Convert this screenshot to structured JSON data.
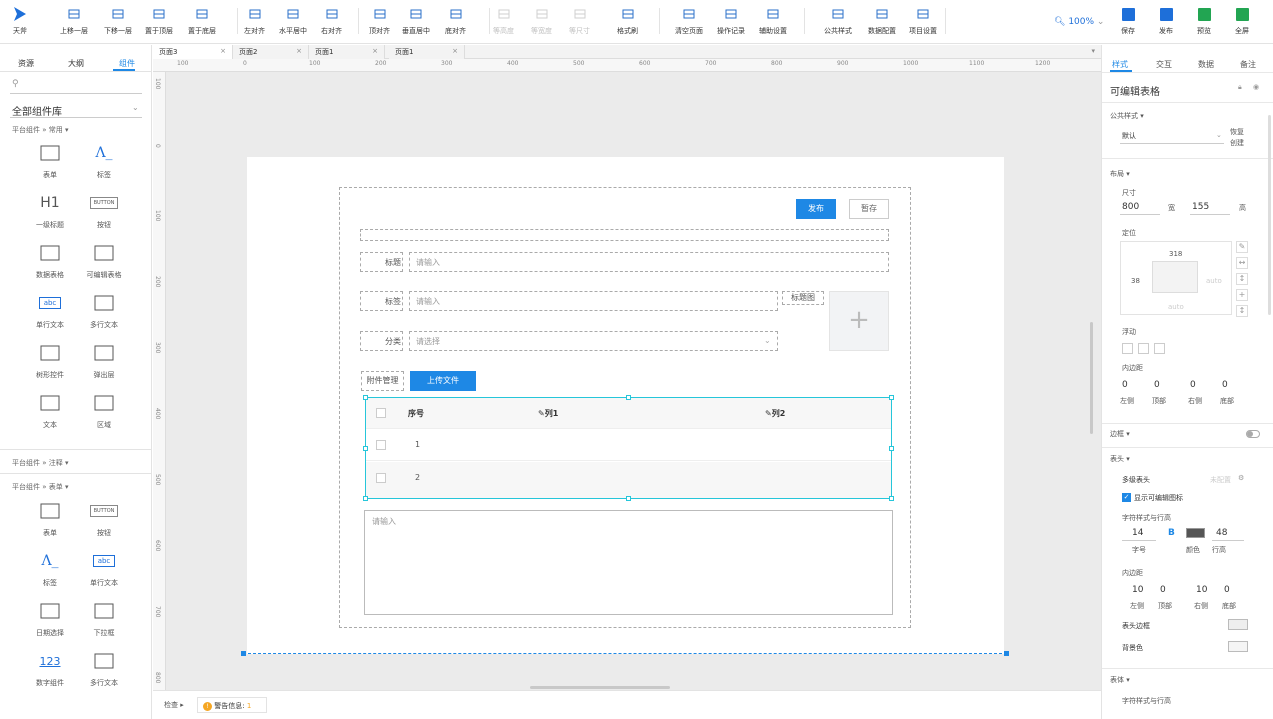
{
  "toolbar": {
    "logo_label": "天斧",
    "items": [
      {
        "label": "上移一层",
        "icon": "move-up-icon",
        "disabled": false
      },
      {
        "label": "下移一层",
        "icon": "move-down-icon",
        "disabled": false
      },
      {
        "label": "置于顶层",
        "icon": "bring-front-icon",
        "disabled": false
      },
      {
        "label": "置于底层",
        "icon": "send-back-icon",
        "disabled": false
      },
      {
        "label": "左对齐",
        "icon": "align-left-icon",
        "disabled": false
      },
      {
        "label": "水平居中",
        "icon": "align-center-h-icon",
        "disabled": false
      },
      {
        "label": "右对齐",
        "icon": "align-right-icon",
        "disabled": false
      },
      {
        "label": "顶对齐",
        "icon": "align-top-icon",
        "disabled": false
      },
      {
        "label": "垂直居中",
        "icon": "align-center-v-icon",
        "disabled": false
      },
      {
        "label": "底对齐",
        "icon": "align-bottom-icon",
        "disabled": false
      },
      {
        "label": "等高度",
        "icon": "same-height-icon",
        "disabled": true
      },
      {
        "label": "等宽度",
        "icon": "same-width-icon",
        "disabled": true
      },
      {
        "label": "等尺寸",
        "icon": "same-size-icon",
        "disabled": true
      },
      {
        "label": "格式刷",
        "icon": "format-brush-icon",
        "disabled": false
      },
      {
        "label": "清空页面",
        "icon": "eraser-icon",
        "disabled": false
      },
      {
        "label": "操作记录",
        "icon": "history-icon",
        "disabled": false
      },
      {
        "label": "辅助设置",
        "icon": "assist-settings-icon",
        "disabled": false
      },
      {
        "label": "公共样式",
        "icon": "public-style-icon",
        "disabled": false
      },
      {
        "label": "数据配置",
        "icon": "database-icon",
        "disabled": false
      },
      {
        "label": "项目设置",
        "icon": "project-settings-icon",
        "disabled": false
      }
    ],
    "zoom": "100%",
    "actions": [
      {
        "label": "保存",
        "icon": "save-icon",
        "color": "#1e6fd9"
      },
      {
        "label": "发布",
        "icon": "publish-icon",
        "color": "#1e6fd9"
      },
      {
        "label": "预览",
        "icon": "preview-icon",
        "color": "#22a552"
      },
      {
        "label": "全屏",
        "icon": "fullscreen-icon",
        "color": "#22a552"
      }
    ]
  },
  "left": {
    "tabs": [
      "资源",
      "大纲",
      "组件"
    ],
    "active_tab": "组件",
    "library": "全部组件库",
    "section1": "平台组件 » 常用",
    "common": [
      {
        "label": "表单",
        "icon": "form-icon"
      },
      {
        "label": "标签",
        "icon": "label-icon",
        "glyph": "A_"
      },
      {
        "label": "一级标题",
        "icon": "heading-icon",
        "glyph": "H1"
      },
      {
        "label": "按钮",
        "icon": "button-icon",
        "glyph": "BUTTON"
      },
      {
        "label": "数据表格",
        "icon": "data-table-icon"
      },
      {
        "label": "可编辑表格",
        "icon": "editable-table-icon"
      },
      {
        "label": "单行文本",
        "icon": "single-line-text-icon",
        "glyph": "abc"
      },
      {
        "label": "多行文本",
        "icon": "multi-line-text-icon"
      },
      {
        "label": "树形控件",
        "icon": "tree-icon"
      },
      {
        "label": "弹出层",
        "icon": "popup-icon"
      },
      {
        "label": "文本",
        "icon": "text-icon"
      },
      {
        "label": "区域",
        "icon": "region-icon"
      }
    ],
    "section2": "平台组件 » 注释",
    "section3": "平台组件 » 表单",
    "forms": [
      {
        "label": "表单",
        "icon": "form-icon"
      },
      {
        "label": "按钮",
        "icon": "button-icon",
        "glyph": "BUTTON"
      },
      {
        "label": "标签",
        "icon": "label-icon",
        "glyph": "A_"
      },
      {
        "label": "单行文本",
        "icon": "single-line-text-icon",
        "glyph": "abc"
      },
      {
        "label": "日期选择",
        "icon": "date-picker-icon"
      },
      {
        "label": "下拉框",
        "icon": "dropdown-icon"
      },
      {
        "label": "数字组件",
        "icon": "number-icon",
        "glyph": "123"
      },
      {
        "label": "多行文本",
        "icon": "multi-line-text-icon"
      }
    ]
  },
  "doc_tabs": [
    "页面3",
    "页面2",
    "页面1",
    "页面1"
  ],
  "ruler_h": [
    "100",
    "0",
    "100",
    "200",
    "300",
    "400",
    "500",
    "600",
    "700",
    "800",
    "900",
    "1000",
    "1100",
    "1200"
  ],
  "ruler_v": [
    "100",
    "0",
    "100",
    "200",
    "300",
    "400",
    "500",
    "600",
    "700",
    "800"
  ],
  "form": {
    "publish_btn": "发布",
    "draft_btn": "暂存",
    "title_label": "标题",
    "title_placeholder": "请输入",
    "tag_label": "标签",
    "tag_placeholder": "请输入",
    "title_image_label": "标题图",
    "category_label": "分类",
    "category_placeholder": "请选择",
    "attachment_label": "附件管理",
    "upload_btn": "上传文件",
    "table_headers": [
      "序号",
      "列1",
      "列2"
    ],
    "table_rows": [
      "1",
      "2"
    ],
    "textarea_placeholder": "请输入"
  },
  "status": {
    "check_label": "检查",
    "warning_label": "警告信息:",
    "warning_count": "1"
  },
  "right": {
    "tabs": [
      "样式",
      "交互",
      "数据",
      "备注"
    ],
    "active_tab": "样式",
    "component_title": "可编辑表格",
    "public_style_label": "公共样式",
    "public_style_value": "默认",
    "restore_label": "恢复",
    "create_label": "创建",
    "layout_label": "布局",
    "size_label": "尺寸",
    "width": "800",
    "width_unit": "宽",
    "height": "155",
    "height_unit": "高",
    "position_label": "定位",
    "pos_top": "318",
    "pos_left": "38",
    "pos_right": "auto",
    "pos_bottom": "auto",
    "float_label": "浮动",
    "padding_label": "内边距",
    "padding_values": [
      "0",
      "0",
      "0",
      "0"
    ],
    "padding_sides": [
      "左侧",
      "顶部",
      "右侧",
      "底部"
    ],
    "border_label": "边框",
    "header_label": "表头",
    "multi_header_label": "多级表头",
    "not_set": "未配置",
    "show_editable_icon": "显示可编辑图标",
    "font_row_label": "字符样式与行高",
    "font_size": "14",
    "font_bold": "B",
    "line_height": "48",
    "font_size_label": "字号",
    "color_label": "颜色",
    "line_height_label": "行高",
    "inner_padding_label": "内边距",
    "inner_padding_values": [
      "10",
      "0",
      "10",
      "0"
    ],
    "inner_padding_sides": [
      "左侧",
      "顶部",
      "右侧",
      "底部"
    ],
    "header_border_label": "表头边框",
    "bg_label": "背景色",
    "body_label": "表体",
    "body_font_label": "字符样式与行高"
  }
}
